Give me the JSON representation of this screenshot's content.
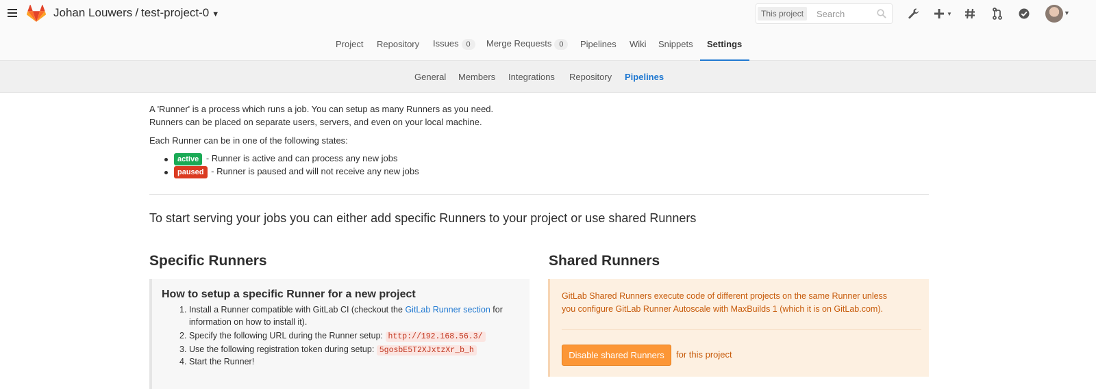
{
  "header": {
    "owner": "Johan Louwers",
    "separator": "/",
    "project": "test-project-0",
    "search_scope": "This project",
    "search_placeholder": "Search"
  },
  "icons": [
    "menu-icon",
    "gitlab-logo",
    "search-icon",
    "wrench-icon",
    "plus-icon",
    "hash-icon",
    "merge-request-icon",
    "todo-check-icon",
    "user-avatar"
  ],
  "project_nav": {
    "items": [
      {
        "label": "Project"
      },
      {
        "label": "Repository"
      },
      {
        "label": "Issues",
        "badge": "0"
      },
      {
        "label": "Merge Requests",
        "badge": "0"
      },
      {
        "label": "Pipelines"
      },
      {
        "label": "Wiki"
      },
      {
        "label": "Snippets"
      },
      {
        "label": "Settings",
        "active": true
      }
    ]
  },
  "settings_nav": {
    "items": [
      {
        "label": "General"
      },
      {
        "label": "Members"
      },
      {
        "label": "Integrations"
      },
      {
        "label": "Repository"
      },
      {
        "label": "Pipelines",
        "active": true
      }
    ]
  },
  "intro": {
    "line1": "A 'Runner' is a process which runs a job. You can setup as many Runners as you need.",
    "line2": "Runners can be placed on separate users, servers, and even on your local machine.",
    "states_heading": "Each Runner can be in one of the following states:",
    "states": [
      {
        "badge": "active",
        "text": " - Runner is active and can process any new jobs"
      },
      {
        "badge": "paused",
        "text": " - Runner is paused and will not receive any new jobs"
      }
    ]
  },
  "lead": "To start serving your jobs you can either add specific Runners to your project or use shared Runners",
  "specific": {
    "heading": "Specific Runners",
    "box_title": "How to setup a specific Runner for a new project",
    "step1_a": "Install a Runner compatible with GitLab CI (checkout the ",
    "step1_link": "GitLab Runner section",
    "step1_b": " for",
    "step1_c": "information on how to install it).",
    "step2": "Specify the following URL during the Runner setup:",
    "step2_code": "http://192.168.56.3/",
    "step3": "Use the following registration token during setup:",
    "step3_code": "5gosbE5T2XJxtzXr_b_h",
    "step4": "Start the Runner!"
  },
  "shared": {
    "heading": "Shared Runners",
    "line1": "GitLab Shared Runners execute code of different projects on the same Runner unless",
    "line2": "you configure GitLab Runner Autoscale with MaxBuilds 1 (which it is on GitLab.com).",
    "button": "Disable shared Runners",
    "suffix": "for this project"
  },
  "colors": {
    "link": "#1f78d1",
    "active_state": "#1aaa55",
    "paused_state": "#db3b21",
    "shared_bg": "#fdf0e1",
    "shared_text": "#c75b0b",
    "button_orange": "#fc9636"
  }
}
